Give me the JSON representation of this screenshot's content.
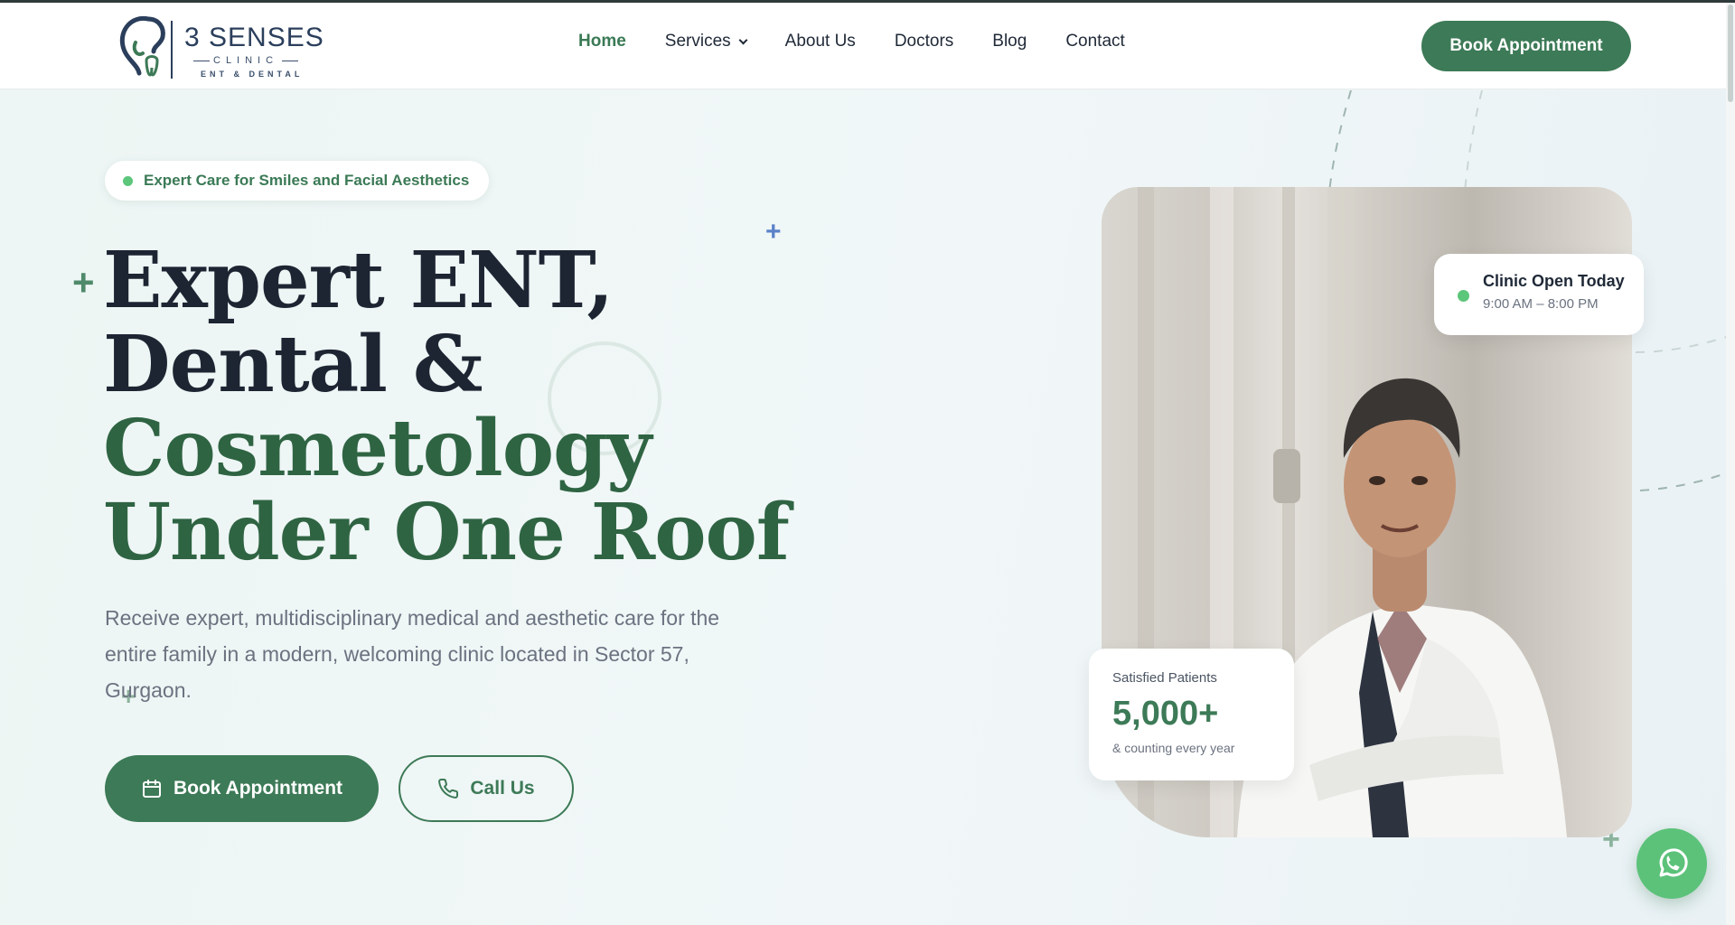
{
  "logo": {
    "brand": "3 SENSES",
    "clinic": "CLINIC",
    "sub": "ENT & DENTAL",
    "icon": "ear-tooth-logo"
  },
  "nav": {
    "items": [
      {
        "label": "Home",
        "active": true
      },
      {
        "label": "Services",
        "has_dropdown": true
      },
      {
        "label": "About Us"
      },
      {
        "label": "Doctors"
      },
      {
        "label": "Blog"
      },
      {
        "label": "Contact"
      }
    ],
    "cta_label": "Book Appointment"
  },
  "hero": {
    "badge": "Expert Care for Smiles and Facial Aesthetics",
    "headline": {
      "line1": "Expert ENT,",
      "line2": "Dental &",
      "line3": "Cosmetology",
      "line4": "Under One Roof"
    },
    "lead": "Receive expert, multidisciplinary medical and aesthetic care for the entire family in a modern, welcoming clinic located in Sector 57, Gurgaon.",
    "primary_button": {
      "label": "Book Appointment",
      "icon": "calendar-icon"
    },
    "secondary_button": {
      "label": "Call Us",
      "icon": "phone-icon"
    }
  },
  "status_card": {
    "title": "Clinic Open Today",
    "hours": "9:00 AM – 8:00 PM"
  },
  "stats_card": {
    "label": "Satisfied Patients",
    "value": "5,000+",
    "note": "& counting every year"
  },
  "colors": {
    "brand_green": "#3d7a57",
    "heading_green": "#2f6443",
    "heading_dark": "#1d2533",
    "status_dot": "#5cc67a",
    "whatsapp": "#5cc27a"
  },
  "floating": {
    "whatsapp_icon": "whatsapp-icon"
  }
}
